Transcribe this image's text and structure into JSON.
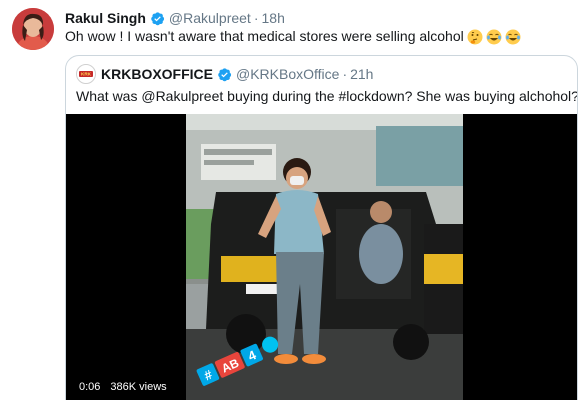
{
  "tweet": {
    "author_name": "Rakul Singh",
    "handle": "@Rakulpreet",
    "separator": "·",
    "time": "18h",
    "text": "Oh wow ! I wasn't aware that medical stores were selling alcohol",
    "emojis": [
      "thinking-face",
      "face-with-tears-of-joy",
      "face-with-tears-of-joy"
    ]
  },
  "quoted_tweet": {
    "author_name": "KRKBOXOFFICE",
    "handle": "@KRKBoxOffice",
    "separator": "·",
    "time": "21h",
    "avatar_text": "KRK",
    "text": "What was @Rakulpreet buying during the #lockdown? She was buying alchohol?",
    "video": {
      "duration": "0:06",
      "views": "386K views",
      "overlay_text": "#AB4"
    }
  },
  "colors": {
    "verified_blue": "#1da1f2",
    "secondary_text": "#657786",
    "border": "#ccd6dd"
  }
}
